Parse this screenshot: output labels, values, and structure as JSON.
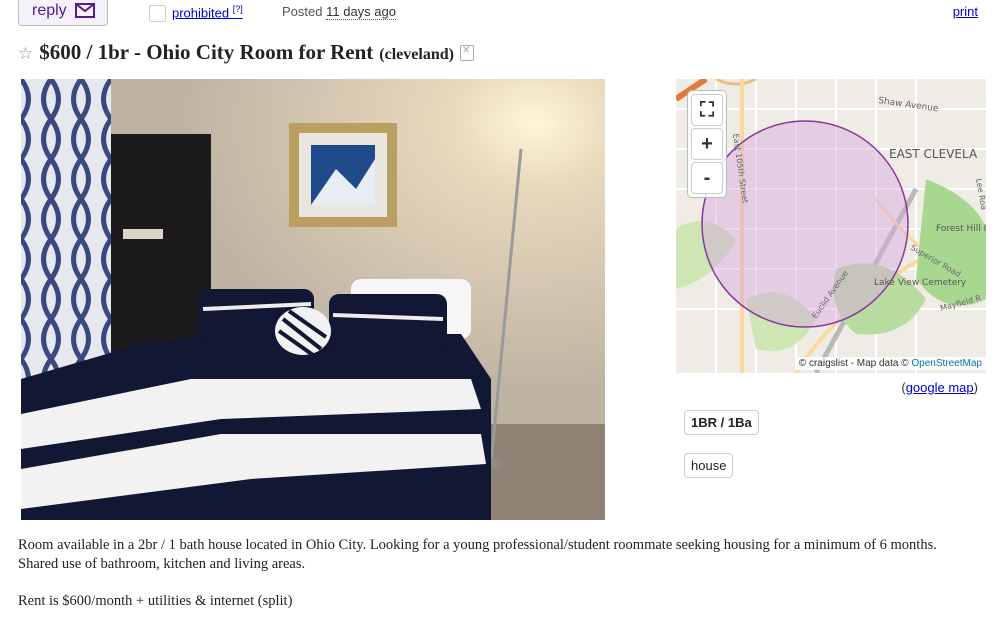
{
  "header": {
    "reply_label": "reply",
    "prohibited_label": "prohibited",
    "prohibited_help": "[?]",
    "posted_label": "Posted",
    "posted_ago": "11 days ago",
    "print_label": "print"
  },
  "listing": {
    "title": "$600 / 1br - Ohio City Room for Rent",
    "location": "(cleveland)",
    "attributes": [
      "1BR / 1Ba",
      "house"
    ],
    "body": [
      "Room available in a 2br / 1 bath house located in Ohio City. Looking for a young professional/student roommate seeking housing for a minimum of 6 months. Shared use of bathroom, kitchen and living areas.",
      "Rent is $600/month + utilities & internet (split)"
    ]
  },
  "map": {
    "labels": {
      "shaw": "Shaw Avenue",
      "east_cleveland": "EAST CLEVELA",
      "e105": "East 105th Street",
      "forest_hill": "Forest Hill Park",
      "superior": "Superior Road",
      "lake_view": "Lake View Cemetery",
      "euclid": "Euclid Avenue",
      "mayfield": "Mayfield R",
      "lee": "Lee Roa"
    },
    "attribution_prefix": "© craigslist - Map data ©",
    "attribution_osm": "OpenStreetMap",
    "google_open": "(",
    "google_map_label": "google map",
    "google_close": ")",
    "controls": {
      "fullscreen": "⛶",
      "zoom_in": "+",
      "zoom_out": "-"
    }
  },
  "colors": {
    "link": "#0000cc",
    "reply": "#551a8b",
    "radius_fill": "#d8a7e0",
    "radius_stroke": "#8a3a9c"
  }
}
